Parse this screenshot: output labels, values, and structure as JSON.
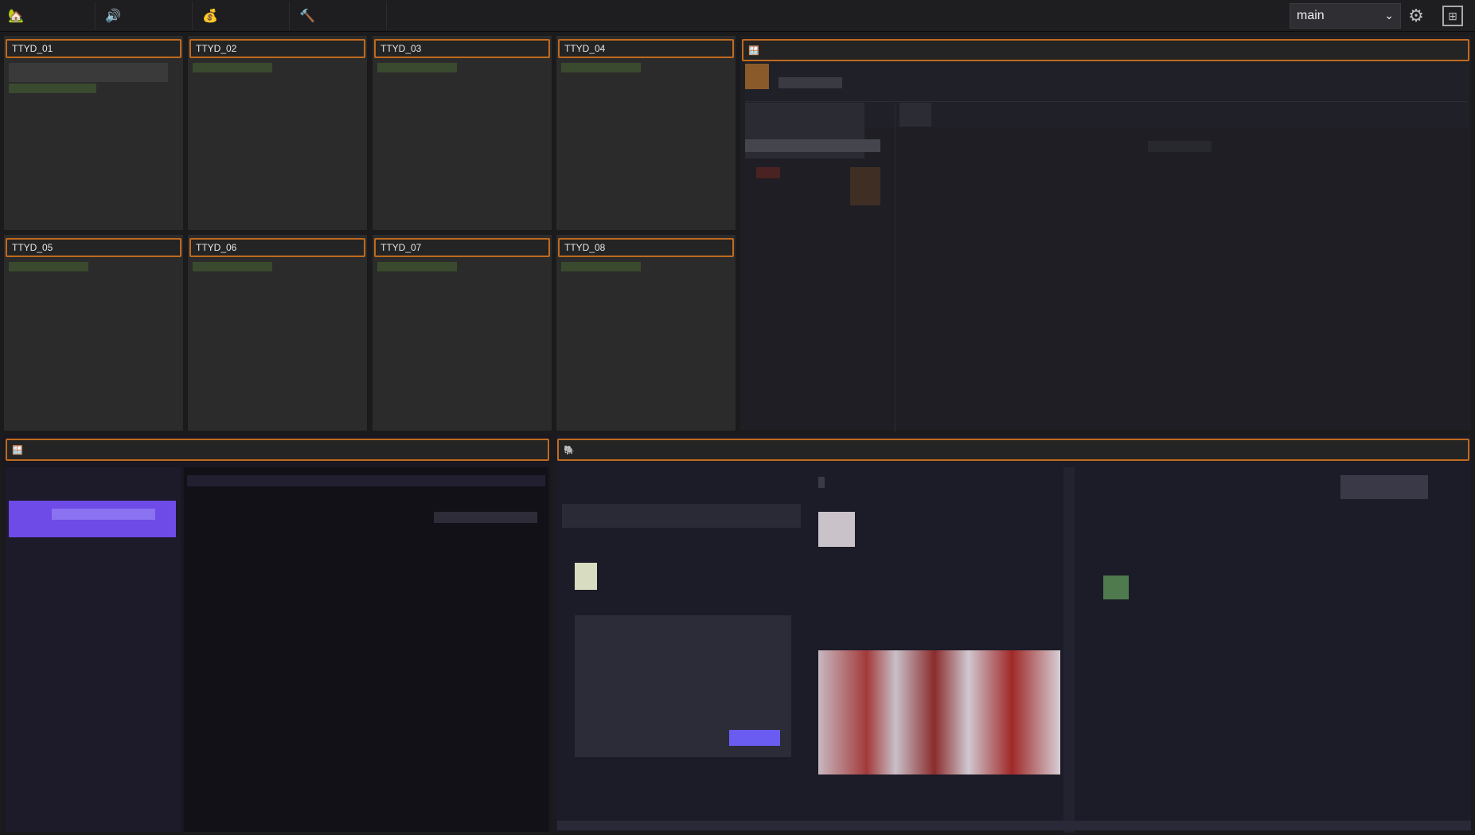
{
  "toolbar": {
    "tabs": [
      {
        "icon": "home-icon",
        "glyph": "🏡"
      },
      {
        "icon": "speaker-icon",
        "glyph": "🔊"
      },
      {
        "icon": "money-bag-icon",
        "glyph": "💰"
      },
      {
        "icon": "hammer-icon",
        "glyph": "🔨"
      }
    ],
    "session_select": "main",
    "settings_icon": "gear-icon",
    "layout_icon": "layout-grid-icon"
  },
  "terminals": [
    "TTYD_01",
    "TTYD_02",
    "TTYD_03",
    "TTYD_04",
    "TTYD_05",
    "TTYD_06",
    "TTYD_07",
    "TTYD_08"
  ],
  "panels": {
    "top_right": {
      "icon": "browser-window-icon",
      "glyph": "🪟"
    },
    "bottom_left": {
      "icon": "browser-window-icon",
      "glyph": "🪟"
    },
    "bottom_right": {
      "icon": "elephant-icon",
      "glyph": "🐘"
    }
  },
  "colors": {
    "accent": "#c06a1e",
    "highlight": "#7a58f0"
  }
}
